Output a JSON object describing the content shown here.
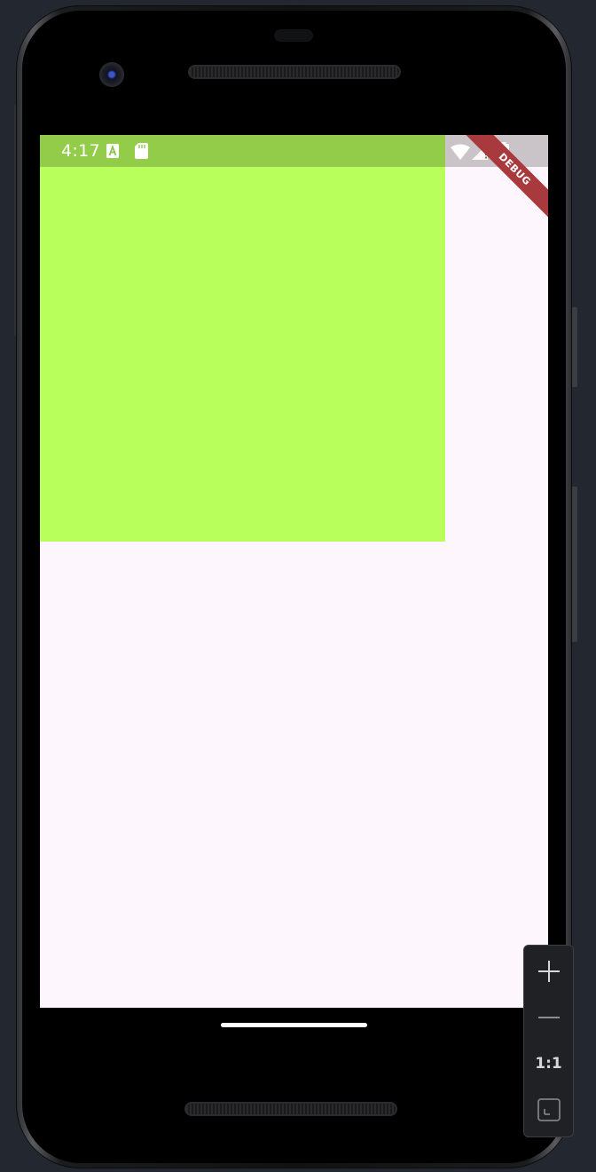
{
  "status_bar": {
    "time": "4:17"
  },
  "debug_banner": {
    "label": "DEBUG"
  },
  "zoom_controls": {
    "actual_size_label": "1:1"
  },
  "colors": {
    "green_box": "#b8ff5c",
    "screen_background": "#fdf6fc",
    "debug_banner": "#a83a3e",
    "emulator_background": "#232730"
  },
  "icons": [
    "sim-a-icon",
    "sd-card-icon",
    "wifi-icon",
    "cell-signal-icon",
    "battery-icon",
    "zoom-in-icon",
    "zoom-out-icon",
    "fit-screen-icon"
  ]
}
